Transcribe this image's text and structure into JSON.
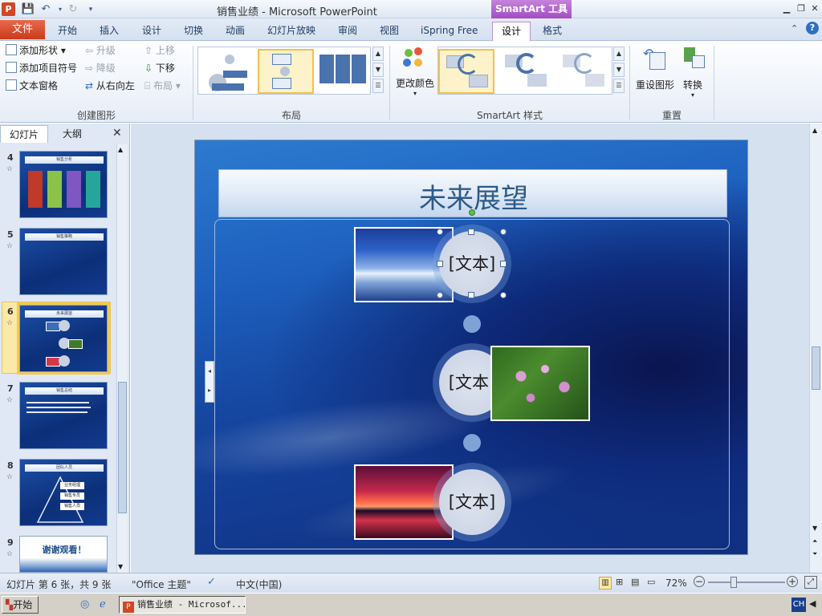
{
  "window": {
    "app_icon": "P",
    "title": "销售业绩  -  Microsoft PowerPoint",
    "context_tab": "SmartArt 工具"
  },
  "qat": {
    "save_icon": "save-icon",
    "undo_icon": "undo-icon",
    "redo_icon": "redo-icon",
    "customize_icon": "dropdown-icon"
  },
  "tabs": [
    "文件",
    "开始",
    "插入",
    "设计",
    "切换",
    "动画",
    "幻灯片放映",
    "审阅",
    "视图",
    "iSpring Free",
    "设计",
    "格式"
  ],
  "ribbon": {
    "create_graphic": {
      "label": "创建图形",
      "add_shape": "添加形状",
      "add_bullet": "添加项目符号",
      "text_pane": "文本窗格",
      "promote": "升级",
      "demote": "降级",
      "right_to_left": "从右向左",
      "move_up": "上移",
      "move_down": "下移",
      "layout": "布局"
    },
    "layouts": {
      "label": "布局"
    },
    "styles": {
      "label": "SmartArt 样式",
      "change_colors": "更改颜色"
    },
    "reset": {
      "label": "重置",
      "reset_graphic": "重设图形",
      "convert": "转换"
    }
  },
  "left_pane": {
    "tab_slides": "幻灯片",
    "tab_outline": "大纲",
    "thumbnails": [
      {
        "num": "4",
        "title": "销售分析"
      },
      {
        "num": "5",
        "title": "销售策略"
      },
      {
        "num": "6",
        "title": "未来展望"
      },
      {
        "num": "7",
        "title": "销售总结"
      },
      {
        "num": "8",
        "title": "团队人员"
      },
      {
        "num": "9",
        "title": "谢谢观看！"
      }
    ],
    "thumb8_items": [
      "业务经理",
      "销售专员",
      "销售人员"
    ],
    "star": "☆"
  },
  "slide": {
    "title": "未来展望",
    "items": [
      "[文本]",
      "[文本]",
      "[文本]"
    ]
  },
  "status": {
    "slide_info": "幻灯片 第 6 张，共 9 张",
    "theme": "\"Office 主题\"",
    "language": "中文(中国)",
    "zoom": "72%"
  },
  "taskbar": {
    "start": "开始",
    "task": "销售业绩 - Microsof...",
    "ime": "CH"
  },
  "colors": {
    "file_tab": "#d24726",
    "context_tab": "#a24cc4",
    "selection": "#f6c94c"
  }
}
